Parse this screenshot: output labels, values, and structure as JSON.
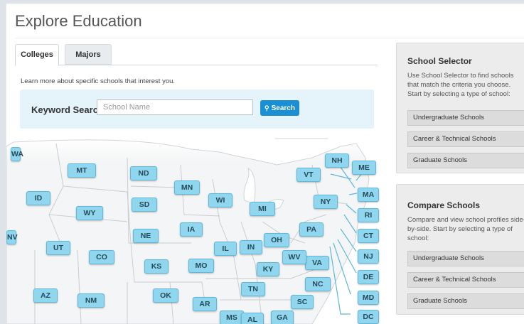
{
  "page": {
    "title": "Explore Education"
  },
  "tabs": [
    {
      "label": "Colleges",
      "active": true
    },
    {
      "label": "Majors",
      "active": false
    }
  ],
  "intro": "Learn more about specific schools that interest you.",
  "search": {
    "label": "Keyword Search",
    "placeholder": "School Name",
    "value": "",
    "button_label": "Search",
    "button_icon": "search-icon"
  },
  "map": {
    "states": [
      "MT",
      "ND",
      "MN",
      "WI",
      "MI",
      "ID",
      "WY",
      "SD",
      "NE",
      "IA",
      "IL",
      "IN",
      "OH",
      "UT",
      "CO",
      "KS",
      "MO",
      "KY",
      "AZ",
      "NM",
      "OK",
      "AR",
      "TN",
      "MS",
      "AL",
      "GA",
      "SC",
      "NC",
      "VA",
      "WV",
      "PA",
      "NY",
      "VT",
      "NH",
      "ME",
      "MA",
      "RI",
      "CT",
      "NJ",
      "DE",
      "MD",
      "DC",
      "NV",
      "WA"
    ]
  },
  "school_selector": {
    "title": "School Selector",
    "description": "Use School Selector to find schools that match the criteria you choose. Start by selecting a type of school:",
    "buttons": [
      "Undergraduate Schools",
      "Career & Technical Schools",
      "Graduate Schools"
    ]
  },
  "compare_schools": {
    "title": "Compare Schools",
    "description": "Compare and view school profiles side-by-side. Start by selecting a type of school:",
    "buttons": [
      "Undergraduate Schools",
      "Career & Technical Schools",
      "Graduate Schools"
    ]
  },
  "colors": {
    "accent": "#1a8fd3",
    "state_fill": "#8fd6ee",
    "search_bg": "#e5f3fa",
    "panel_bg": "#ececec"
  }
}
